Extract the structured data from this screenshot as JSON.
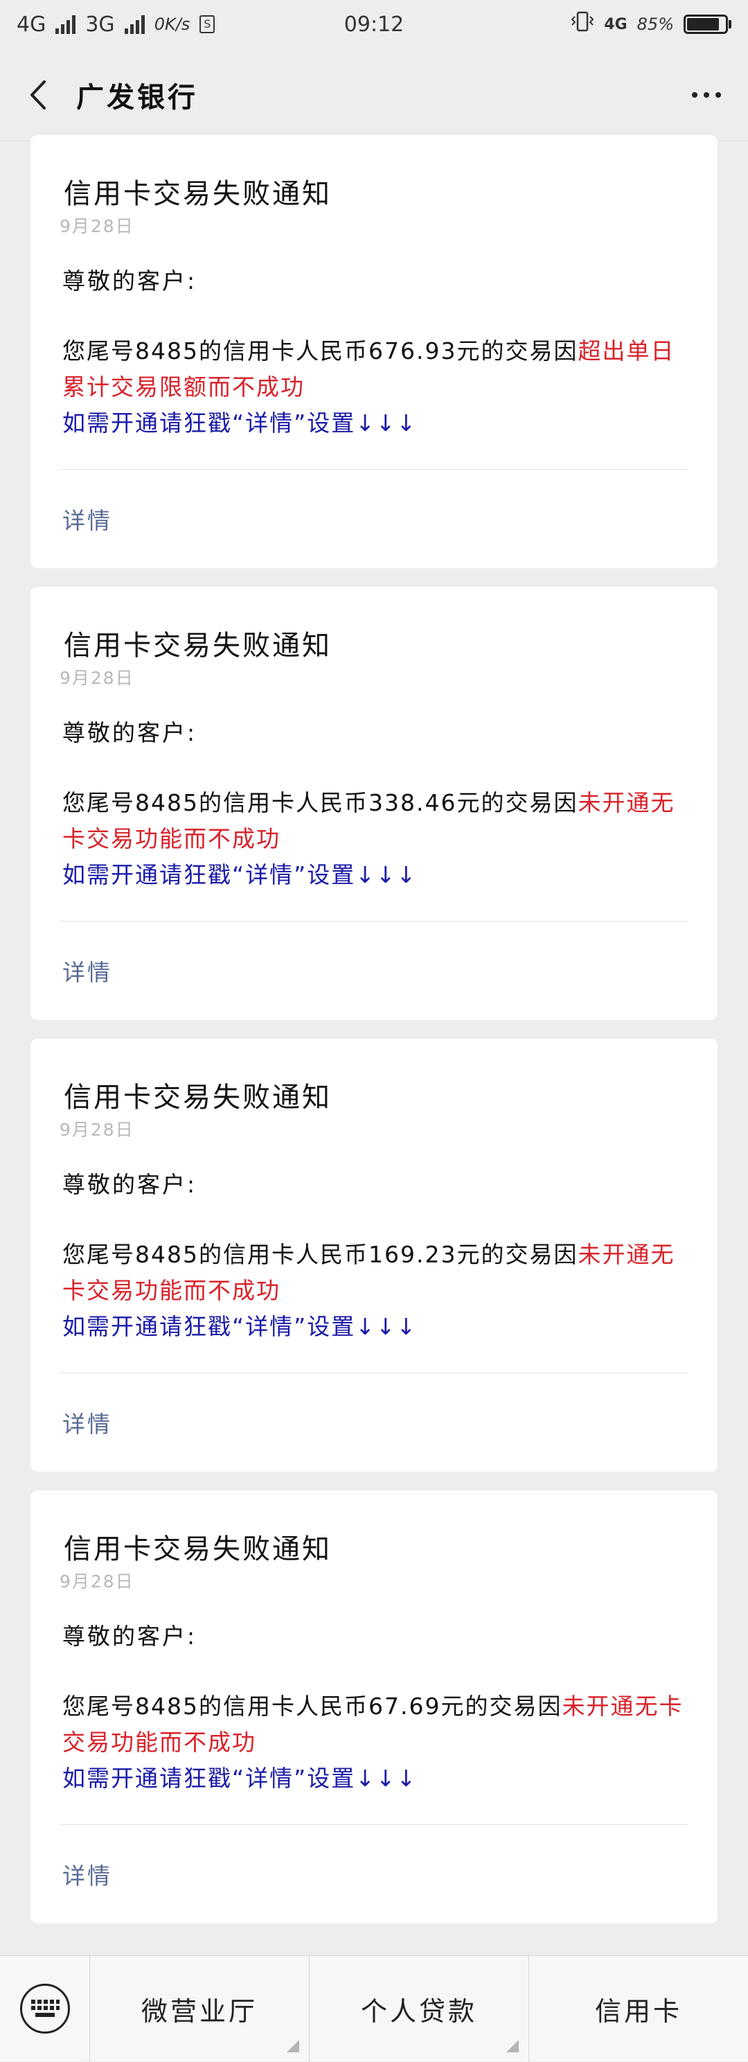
{
  "status_bar": {
    "network1": "4G",
    "network2": "3G",
    "speed": "0K/s",
    "time": "09:12",
    "right_network": "4G",
    "battery": "85%"
  },
  "nav": {
    "title": "广发银行"
  },
  "messages": [
    {
      "title": "信用卡交易失败通知",
      "date": "9月28日",
      "greeting": "尊敬的客户:",
      "body_black": "您尾号8485的信用卡人民币676.93元的交易因",
      "body_red": "超出单日累计交易限额而不成功",
      "body_blue": "如需开通请狂戳“详情”设置↓↓↓",
      "detail": "详情"
    },
    {
      "title": "信用卡交易失败通知",
      "date": "9月28日",
      "greeting": "尊敬的客户:",
      "body_black": "您尾号8485的信用卡人民币338.46元的交易因",
      "body_red": "未开通无卡交易功能而不成功",
      "body_blue": "如需开通请狂戳“详情”设置↓↓↓",
      "detail": "详情"
    },
    {
      "title": "信用卡交易失败通知",
      "date": "9月28日",
      "greeting": "尊敬的客户:",
      "body_black": "您尾号8485的信用卡人民币169.23元的交易因",
      "body_red": "未开通无卡交易功能而不成功",
      "body_blue": "如需开通请狂戳“详情”设置↓↓↓",
      "detail": "详情"
    },
    {
      "title": "信用卡交易失败通知",
      "date": "9月28日",
      "greeting": "尊敬的客户:",
      "body_black": "您尾号8485的信用卡人民币67.69元的交易因",
      "body_red": "未开通无卡交易功能而不成功",
      "body_blue": "如需开通请狂戳“详情”设置↓↓↓",
      "detail": "详情"
    }
  ],
  "bottom_menu": {
    "items": [
      "微营业厅",
      "个人贷款",
      "信用卡"
    ]
  },
  "icons": {
    "back": "chevron-left-icon",
    "more": "more-dots-icon",
    "keyboard": "keyboard-icon",
    "battery": "battery-icon",
    "vibrate": "vibrate-icon"
  }
}
